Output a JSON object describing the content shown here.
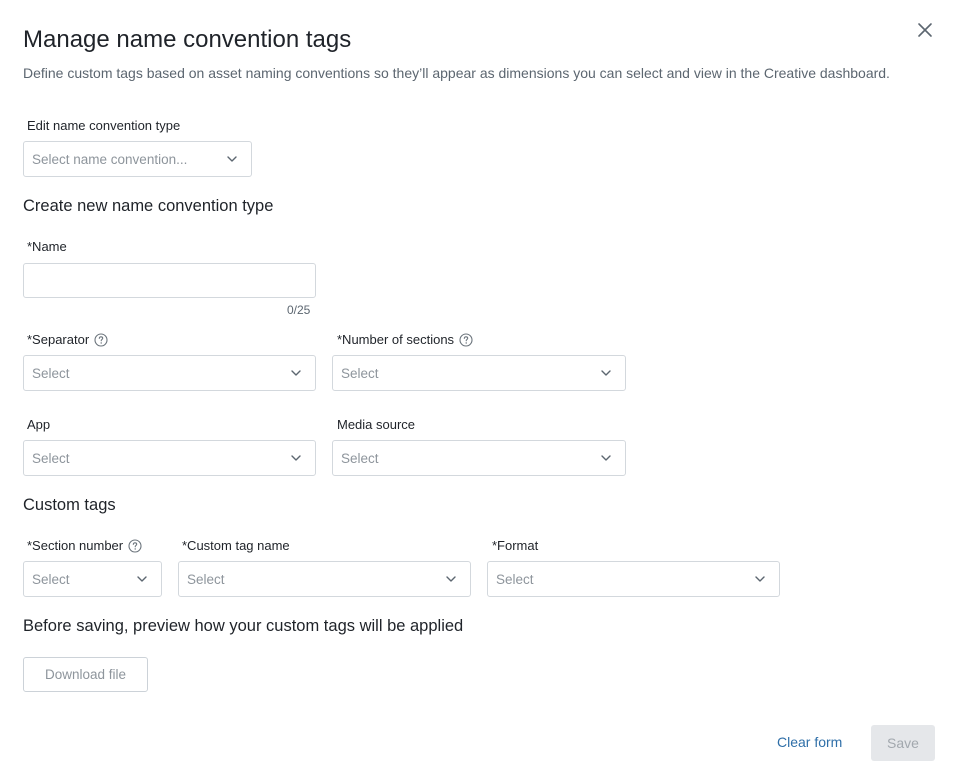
{
  "dialog": {
    "title": "Manage name convention tags",
    "description": "Define custom tags based on asset naming conventions so they’ll appear as dimensions you can select and view in the Creative dashboard.",
    "close_icon": "close-icon"
  },
  "edit_type": {
    "label": "Edit name convention type",
    "placeholder": "Select name convention..."
  },
  "create_section": {
    "title": "Create new name convention type",
    "name_label": "*Name",
    "name_value": "",
    "name_counter": "0/25",
    "separator_label": "*Separator",
    "separator_value": "Select",
    "sections_label": "*Number of sections",
    "sections_value": "Select",
    "app_label": "App",
    "app_value": "Select",
    "media_source_label": "Media source",
    "media_source_value": "Select"
  },
  "custom_tags": {
    "title": "Custom tags",
    "section_number_label": "*Section number",
    "section_number_value": "Select",
    "tag_name_label": "*Custom tag name",
    "tag_name_value": "Select",
    "format_label": "*Format",
    "format_value": "Select"
  },
  "preview": {
    "title": "Before saving, preview how your custom tags will be applied",
    "download_label": "Download file"
  },
  "footer": {
    "clear_label": "Clear form",
    "save_label": "Save"
  },
  "colors": {
    "link": "#2f6fa8",
    "disabled_bg": "#e5e7ea",
    "border": "#d3d8dd",
    "placeholder": "#8e959c"
  }
}
